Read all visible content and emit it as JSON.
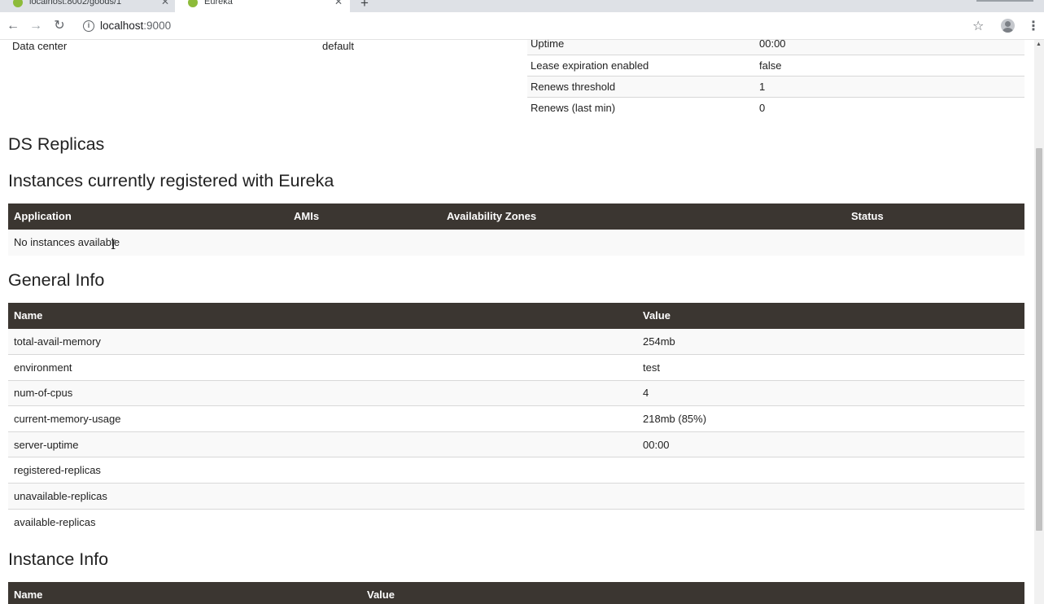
{
  "browser": {
    "tabs": [
      {
        "title": "localhost:8002/goods/1",
        "active": false
      },
      {
        "title": "Eureka",
        "active": true
      }
    ],
    "url_host": "localhost",
    "url_port": ":9000"
  },
  "top_info": {
    "data_center_label": "Data center",
    "data_center_value": "default",
    "status_rows": [
      {
        "name": "Uptime",
        "value": "00:00"
      },
      {
        "name": "Lease expiration enabled",
        "value": "false"
      },
      {
        "name": "Renews threshold",
        "value": "1"
      },
      {
        "name": "Renews (last min)",
        "value": "0"
      }
    ]
  },
  "ds_replicas_title": "DS Replicas",
  "instances": {
    "title": "Instances currently registered with Eureka",
    "columns": [
      "Application",
      "AMIs",
      "Availability Zones",
      "Status"
    ],
    "empty_text": "No instances available"
  },
  "general_info": {
    "title": "General Info",
    "columns": [
      "Name",
      "Value"
    ],
    "rows": [
      {
        "name": "total-avail-memory",
        "value": "254mb"
      },
      {
        "name": "environment",
        "value": "test"
      },
      {
        "name": "num-of-cpus",
        "value": "4"
      },
      {
        "name": "current-memory-usage",
        "value": "218mb (85%)"
      },
      {
        "name": "server-uptime",
        "value": "00:00"
      },
      {
        "name": "registered-replicas",
        "value": ""
      },
      {
        "name": "unavailable-replicas",
        "value": ""
      },
      {
        "name": "available-replicas",
        "value": ""
      }
    ]
  },
  "instance_info": {
    "title": "Instance Info",
    "columns": [
      "Name",
      "Value"
    ]
  },
  "colors": {
    "table_header_bg": "#3b3631",
    "striped_row_bg": "#f9f9f9",
    "favicon": "#8dbb3a"
  }
}
